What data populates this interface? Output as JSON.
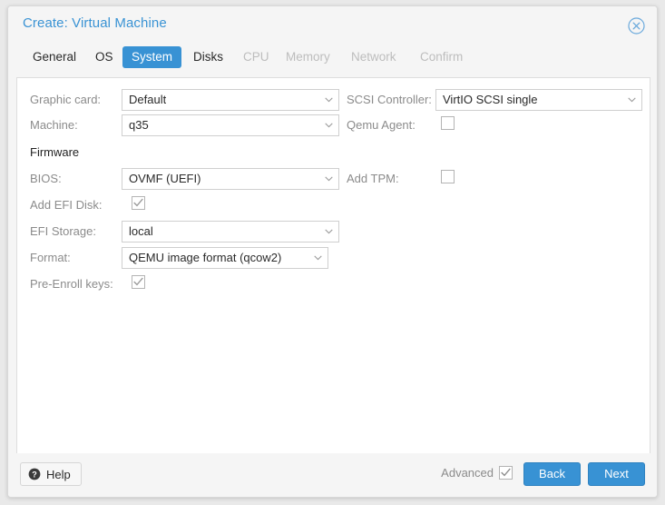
{
  "window": {
    "title": "Create: Virtual Machine",
    "close_icon": "close-circle-icon"
  },
  "tabs": [
    {
      "label": "General",
      "state": "enabled"
    },
    {
      "label": "OS",
      "state": "enabled"
    },
    {
      "label": "System",
      "state": "active"
    },
    {
      "label": "Disks",
      "state": "enabled"
    },
    {
      "label": "CPU",
      "state": "disabled"
    },
    {
      "label": "Memory",
      "state": "disabled"
    },
    {
      "label": "Network",
      "state": "disabled"
    },
    {
      "label": "Confirm",
      "state": "disabled"
    }
  ],
  "form": {
    "left": {
      "graphic_card": {
        "label": "Graphic card:",
        "value": "Default"
      },
      "machine": {
        "label": "Machine:",
        "value": "q35"
      },
      "firmware_section": {
        "label": "Firmware"
      },
      "bios": {
        "label": "BIOS:",
        "value": "OVMF (UEFI)"
      },
      "add_efi_disk": {
        "label": "Add EFI Disk:",
        "checked": true
      },
      "efi_storage": {
        "label": "EFI Storage:",
        "value": "local"
      },
      "format": {
        "label": "Format:",
        "value": "QEMU image format (qcow2)"
      },
      "pre_enroll_keys": {
        "label": "Pre-Enroll keys:",
        "checked": true
      }
    },
    "right": {
      "scsi_controller": {
        "label": "SCSI Controller:",
        "value": "VirtIO SCSI single"
      },
      "qemu_agent": {
        "label": "Qemu Agent:",
        "checked": false
      },
      "add_tpm": {
        "label": "Add TPM:",
        "checked": false
      }
    }
  },
  "footer": {
    "help_label": "Help",
    "help_icon": "question-mark-circle-icon",
    "advanced_label": "Advanced",
    "advanced_checked": true,
    "back_label": "Back",
    "next_label": "Next"
  },
  "colors": {
    "accent": "#3892d4",
    "title_text": "#3a93d4",
    "label_text": "#8b8b8b",
    "value_text": "#2a2a2a",
    "disabled_tab": "#bdbdbd",
    "dialog_bg": "#f5f5f5",
    "panel_bg": "#ffffff",
    "page_bg": "#e9e9e9"
  }
}
